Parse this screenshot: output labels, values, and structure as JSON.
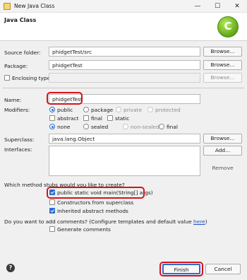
{
  "window": {
    "title": "New Java Class",
    "minimize": "—",
    "maximize": "☐",
    "close": "✕"
  },
  "banner": {
    "title": "Java Class",
    "logo_letter": "C"
  },
  "source_folder": {
    "label": "Source folder:",
    "value": "phidgetTest/src",
    "browse": "Browse..."
  },
  "package": {
    "label": "Package:",
    "value": "phidgetTest",
    "browse": "Browse..."
  },
  "enclosing": {
    "label": "Enclosing type:",
    "value": "",
    "browse": "Browse...",
    "checked": false
  },
  "name": {
    "label": "Name:",
    "value": "phidgetTest"
  },
  "modifiers": {
    "label": "Modifiers:",
    "row1": [
      "public",
      "package",
      "private",
      "protected"
    ],
    "row2": [
      "abstract",
      "final",
      "static"
    ],
    "row3": [
      "none",
      "sealed",
      "non-sealed",
      "final"
    ]
  },
  "superclass": {
    "label": "Superclass:",
    "value": "java.lang.Object",
    "browse": "Browse..."
  },
  "interfaces": {
    "label": "Interfaces:",
    "add": "Add...",
    "remove": "Remove"
  },
  "stubs": {
    "question": "Which method stubs would you like to create?",
    "main": "public static void main(String[] args)",
    "constructors": "Constructors from superclass",
    "inherited": "Inherited abstract methods"
  },
  "comments": {
    "question": "Do you want to add comments? (Configure templates and default value ",
    "link": "here",
    "question_end": ")",
    "generate": "Generate comments"
  },
  "footer": {
    "help": "?",
    "finish": "Finish",
    "cancel": "Cancel"
  },
  "colors": {
    "highlight": "#d4141b",
    "accent": "#2e6cd1"
  }
}
